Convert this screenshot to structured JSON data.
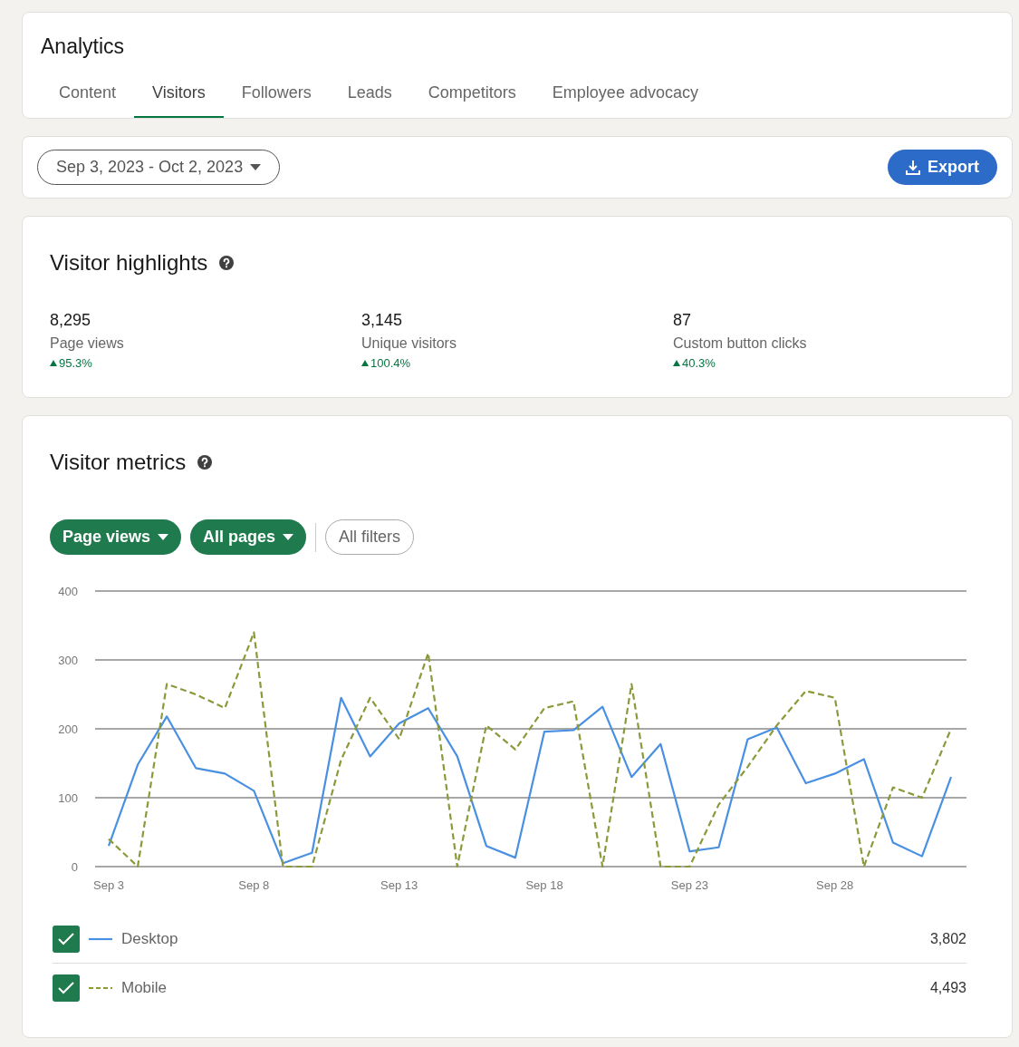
{
  "header": {
    "title": "Analytics"
  },
  "tabs": [
    {
      "label": "Content",
      "selected": false
    },
    {
      "label": "Visitors",
      "selected": true
    },
    {
      "label": "Followers",
      "selected": false
    },
    {
      "label": "Leads",
      "selected": false
    },
    {
      "label": "Competitors",
      "selected": false
    },
    {
      "label": "Employee advocacy",
      "selected": false
    }
  ],
  "toolbar": {
    "date_range": "Sep 3, 2023 - Oct 2, 2023",
    "export": "Export"
  },
  "highlights": {
    "title": "Visitor highlights",
    "items": [
      {
        "value": "8,295",
        "label": "Page views",
        "change": "95.3%"
      },
      {
        "value": "3,145",
        "label": "Unique visitors",
        "change": "100.4%"
      },
      {
        "value": "87",
        "label": "Custom button clicks",
        "change": "40.3%"
      }
    ]
  },
  "metrics": {
    "title": "Visitor metrics",
    "filters": [
      {
        "label": "Page views",
        "kind": "dropdown"
      },
      {
        "label": "All pages",
        "kind": "dropdown"
      },
      {
        "label": "All filters",
        "kind": "outline"
      }
    ],
    "chart_data": {
      "type": "line",
      "ylim": [
        0,
        400
      ],
      "yticks": [
        0,
        100,
        200,
        300,
        400
      ],
      "grid": true,
      "categories": [
        "Sep 3",
        null,
        null,
        null,
        null,
        "Sep 8",
        null,
        null,
        null,
        null,
        "Sep 13",
        null,
        null,
        null,
        null,
        "Sep 18",
        null,
        null,
        null,
        null,
        "Sep 23",
        null,
        null,
        null,
        null,
        "Sep 28",
        null,
        null,
        null,
        null
      ],
      "series": [
        {
          "name": "Desktop",
          "color": "#4a90e2",
          "line_style": "solid",
          "values": [
            30,
            148,
            218,
            143,
            135,
            110,
            5,
            20,
            245,
            160,
            208,
            230,
            160,
            30,
            13,
            196,
            198,
            232,
            130,
            178,
            22,
            28,
            185,
            202,
            121,
            135,
            156,
            35,
            15,
            130
          ]
        },
        {
          "name": "Mobile",
          "color": "#8a9a3a",
          "line_style": "dashed",
          "values": [
            40,
            0,
            265,
            250,
            230,
            340,
            0,
            0,
            155,
            245,
            185,
            310,
            0,
            205,
            170,
            230,
            240,
            0,
            265,
            0,
            0,
            90,
            145,
            205,
            255,
            245,
            0,
            115,
            100,
            200
          ]
        }
      ]
    },
    "legend": [
      {
        "total": "3,802",
        "checked": true
      },
      {
        "total": "4,493",
        "checked": true
      }
    ]
  }
}
